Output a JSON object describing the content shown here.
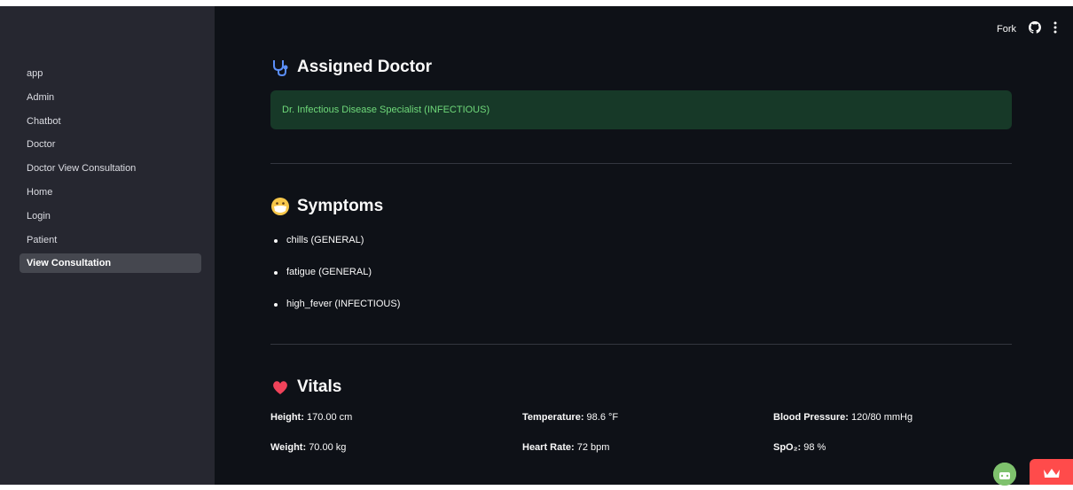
{
  "sidebar": {
    "items": [
      {
        "label": "app",
        "active": false
      },
      {
        "label": "Admin",
        "active": false
      },
      {
        "label": "Chatbot",
        "active": false
      },
      {
        "label": "Doctor",
        "active": false
      },
      {
        "label": "Doctor View Consultation",
        "active": false
      },
      {
        "label": "Home",
        "active": false
      },
      {
        "label": "Login",
        "active": false
      },
      {
        "label": "Patient",
        "active": false
      },
      {
        "label": "View Consultation",
        "active": true
      }
    ]
  },
  "toolbar": {
    "fork_label": "Fork",
    "github_icon": "github-icon",
    "menu_icon": "kebab-menu-icon"
  },
  "assigned_doctor": {
    "icon": "stethoscope-icon",
    "title": "Assigned Doctor",
    "doctor_text": "Dr. Infectious Disease Specialist (INFECTIOUS)"
  },
  "symptoms": {
    "icon": "face-with-mask-icon",
    "title": "Symptoms",
    "items": [
      "chills (GENERAL)",
      "fatigue (GENERAL)",
      "high_fever (INFECTIOUS)"
    ]
  },
  "vitals": {
    "icon": "heart-icon",
    "title": "Vitals",
    "height_label": "Height:",
    "height_value": "170.00 cm",
    "weight_label": "Weight:",
    "weight_value": "70.00 kg",
    "temperature_label": "Temperature:",
    "temperature_value": "98.6 °F",
    "heart_rate_label": "Heart Rate:",
    "heart_rate_value": "72 bpm",
    "bp_label": "Blood Pressure:",
    "bp_value": "120/80 mmHg",
    "spo2_label": "SpO₂:",
    "spo2_value": "98 %"
  },
  "colors": {
    "sidebar_bg": "#262730",
    "main_bg": "#0e1117",
    "success_bg": "#173928",
    "success_text": "#6fd97a",
    "accent_red": "#ff4b4b"
  }
}
